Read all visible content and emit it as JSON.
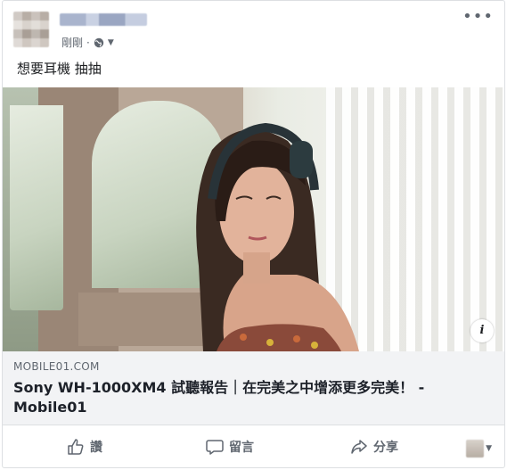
{
  "post": {
    "author": "",
    "time": "剛剛",
    "text": "想要耳機 抽抽"
  },
  "link": {
    "domain": "MOBILE01.COM",
    "title": "Sony WH-1000XM4 試聽報告｜在完美之中增添更多完美！ - Mobile01"
  },
  "actions": {
    "like": "讚",
    "comment": "留言",
    "share": "分享"
  },
  "icons": {
    "more": "more-icon",
    "privacy": "globe-icon",
    "info": "info-icon"
  },
  "colors": {
    "meta_text": "#606770",
    "link_bg": "#f2f3f5",
    "border": "#dddfe2"
  }
}
